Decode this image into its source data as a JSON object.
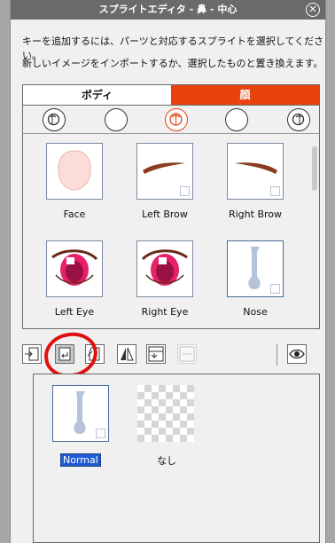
{
  "window": {
    "title": "スプライトエディタ - 鼻 - 中心",
    "close_icon": "close-circle-icon"
  },
  "instructions": {
    "line1": "キーを追加するには、パーツと対応するスプライトを選択してください。",
    "line2": "新しいイメージをインポートするか、選択したものと置き換えます。"
  },
  "tabs": [
    {
      "label": "ボディ",
      "active": false
    },
    {
      "label": "顔",
      "active": true
    }
  ],
  "colors": {
    "accent": "#e8420f",
    "selection": "#1f5ad6",
    "annotation": "#e01010"
  },
  "angles": [
    {
      "icon": "head-left-icon",
      "active": false
    },
    {
      "icon": "empty-angle-icon",
      "active": false
    },
    {
      "icon": "head-front-icon",
      "active": true
    },
    {
      "icon": "empty-angle-icon",
      "active": false
    },
    {
      "icon": "head-right-icon",
      "active": false
    }
  ],
  "sprites": [
    {
      "label": "Face",
      "icon": "face-sprite"
    },
    {
      "label": "Left Brow",
      "icon": "left-brow-sprite"
    },
    {
      "label": "Right Brow",
      "icon": "right-brow-sprite"
    },
    {
      "label": "Left Eye",
      "icon": "left-eye-sprite"
    },
    {
      "label": "Right Eye",
      "icon": "right-eye-sprite"
    },
    {
      "label": "Nose",
      "icon": "nose-sprite",
      "selected": true
    }
  ],
  "toolbar": [
    {
      "name": "import-button",
      "icon": "import-icon"
    },
    {
      "name": "replace-button",
      "icon": "replace-icon",
      "active": true
    },
    {
      "name": "export-button",
      "icon": "export-icon"
    },
    {
      "name": "flip-button",
      "icon": "flip-icon"
    },
    {
      "name": "image-settings-button",
      "icon": "image-settings-icon"
    },
    {
      "name": "svg-button",
      "icon": "svg-icon",
      "disabled": true
    },
    {
      "name": "visibility-button",
      "icon": "eye-icon"
    }
  ],
  "variants": [
    {
      "label": "Normal",
      "selected": true
    },
    {
      "label": "なし",
      "selected": false
    }
  ]
}
